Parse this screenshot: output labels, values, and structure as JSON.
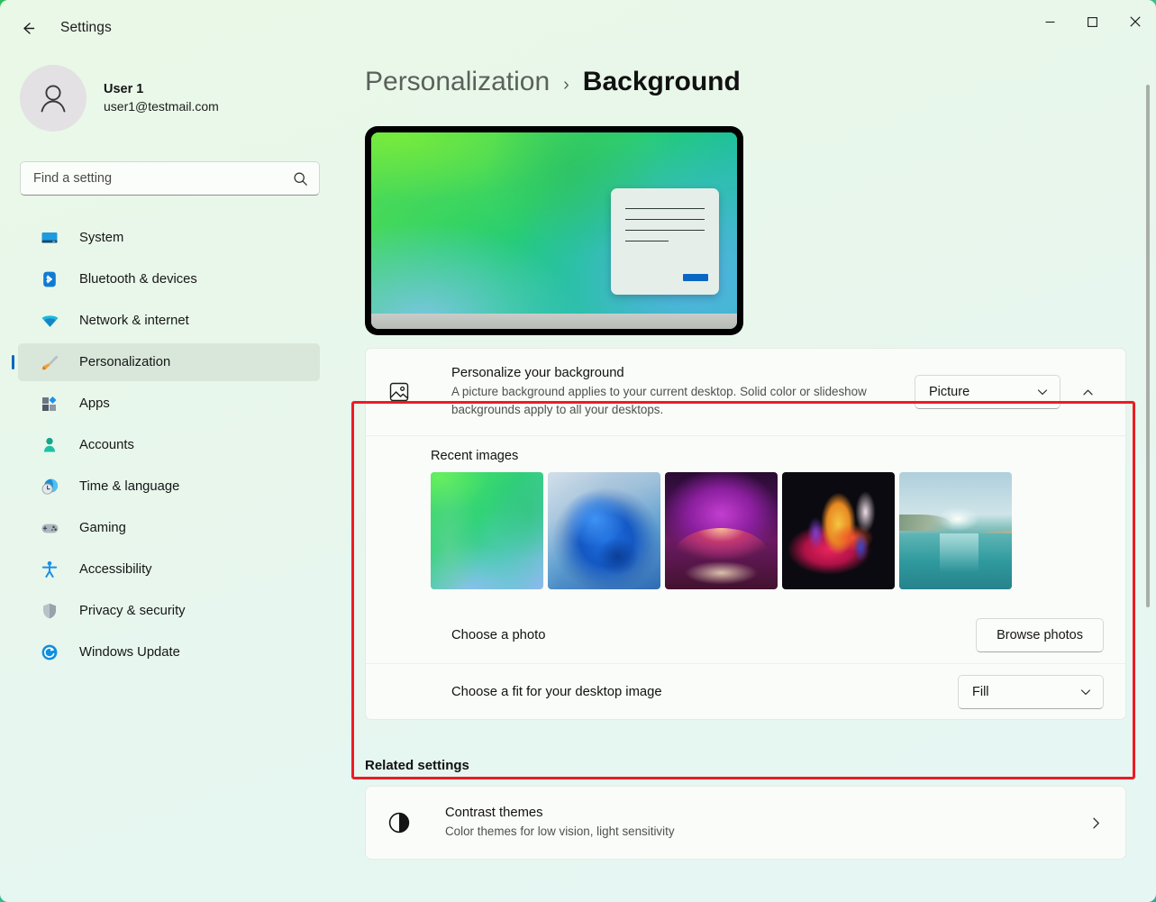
{
  "window": {
    "title": "Settings",
    "back_label": "Back",
    "minimize_label": "Minimize",
    "maximize_label": "Maximize",
    "close_label": "Close"
  },
  "account": {
    "name": "User 1",
    "email": "user1@testmail.com"
  },
  "search": {
    "placeholder": "Find a setting",
    "value": ""
  },
  "sidebar": {
    "items": [
      {
        "label": "System",
        "icon": "monitor-icon",
        "selected": false
      },
      {
        "label": "Bluetooth & devices",
        "icon": "bluetooth-icon",
        "selected": false
      },
      {
        "label": "Network & internet",
        "icon": "wifi-icon",
        "selected": false
      },
      {
        "label": "Personalization",
        "icon": "paintbrush-icon",
        "selected": true
      },
      {
        "label": "Apps",
        "icon": "apps-icon",
        "selected": false
      },
      {
        "label": "Accounts",
        "icon": "person-icon",
        "selected": false
      },
      {
        "label": "Time & language",
        "icon": "clock-globe-icon",
        "selected": false
      },
      {
        "label": "Gaming",
        "icon": "gamepad-icon",
        "selected": false
      },
      {
        "label": "Accessibility",
        "icon": "accessibility-icon",
        "selected": false
      },
      {
        "label": "Privacy & security",
        "icon": "shield-icon",
        "selected": false
      },
      {
        "label": "Windows Update",
        "icon": "update-icon",
        "selected": false
      }
    ]
  },
  "breadcrumb": {
    "parent": "Personalization",
    "separator": "›",
    "current": "Background"
  },
  "preview": {
    "name": "desktop-wallpaper-preview"
  },
  "background_card": {
    "personalize": {
      "title": "Personalize your background",
      "description": "A picture background applies to your current desktop. Solid color or slideshow backgrounds apply to all your desktops.",
      "dropdown_value": "Picture",
      "expander_state": "expanded"
    },
    "recent_images": {
      "label": "Recent images",
      "thumbnails": [
        {
          "name": "green-abstract-wallpaper",
          "selected": true
        },
        {
          "name": "blue-bloom-wallpaper",
          "selected": false
        },
        {
          "name": "purple-glow-wallpaper",
          "selected": false
        },
        {
          "name": "colorful-flower-wallpaper",
          "selected": false
        },
        {
          "name": "lake-sunrise-wallpaper",
          "selected": false
        }
      ]
    },
    "choose_photo": {
      "label": "Choose a photo",
      "button_label": "Browse photos"
    },
    "choose_fit": {
      "label": "Choose a fit for your desktop image",
      "dropdown_value": "Fill"
    }
  },
  "related_settings": {
    "heading": "Related settings",
    "items": [
      {
        "title": "Contrast themes",
        "description": "Color themes for low vision, light sensitivity",
        "icon": "contrast-icon"
      }
    ]
  },
  "colors": {
    "accent": "#0067c0",
    "highlight_border": "#ec1c24",
    "window_background": "#e8f6ec",
    "desktop": "#2fbf5a"
  }
}
